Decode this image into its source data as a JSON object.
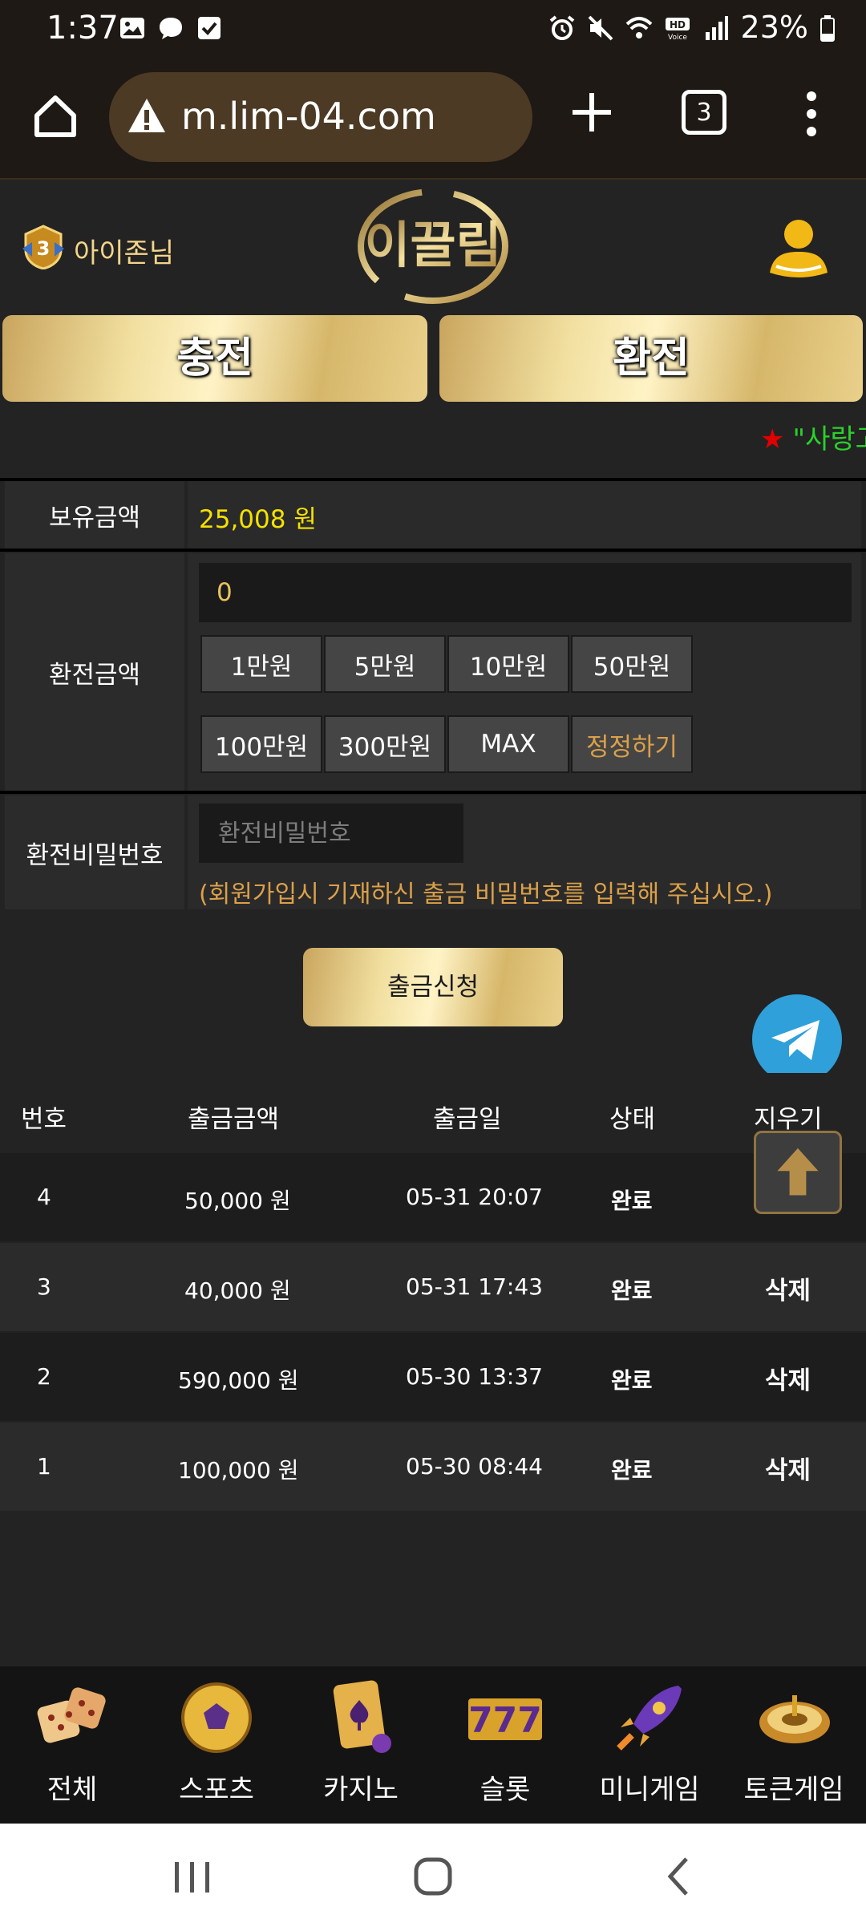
{
  "status_bar": {
    "time": "1:37",
    "battery": "23%"
  },
  "browser": {
    "url": "m.lim-04.com",
    "tab_count": "3"
  },
  "header": {
    "user_name": "아이존님",
    "level_badge": "3",
    "logo_text": "이끌림"
  },
  "actions": {
    "charge_label": "충전",
    "exchange_label": "환전"
  },
  "marquee": {
    "star": "★",
    "text": "\"사랑고"
  },
  "form": {
    "balance_label": "보유금액",
    "balance_value": "25,008 원",
    "amount_label": "환전금액",
    "amount_value": "0",
    "amount_buttons": [
      "1만원",
      "5만원",
      "10만원",
      "50만원",
      "100만원",
      "300만원",
      "MAX",
      "정정하기"
    ],
    "password_label": "환전비밀번호",
    "password_placeholder": "환전비밀번호",
    "password_hint": "(회원가입시 기재하신 출금 비밀번호를 입력해 주십시오.)",
    "submit_label": "출금신청"
  },
  "history": {
    "headers": [
      "번호",
      "출금금액",
      "출금일",
      "상태",
      "지우기"
    ],
    "rows": [
      {
        "no": "4",
        "amount": "50,000 원",
        "date": "05-31 20:07",
        "status": "완료",
        "delete": ""
      },
      {
        "no": "3",
        "amount": "40,000 원",
        "date": "05-31 17:43",
        "status": "완료",
        "delete": "삭제"
      },
      {
        "no": "2",
        "amount": "590,000 원",
        "date": "05-30 13:37",
        "status": "완료",
        "delete": "삭제"
      },
      {
        "no": "1",
        "amount": "100,000 원",
        "date": "05-30 08:44",
        "status": "완료",
        "delete": "삭제"
      }
    ]
  },
  "bottom_nav": [
    {
      "label": "전체",
      "icon": "dice-icon"
    },
    {
      "label": "스포츠",
      "icon": "soccer-ball-icon"
    },
    {
      "label": "카지노",
      "icon": "cards-icon"
    },
    {
      "label": "슬롯",
      "icon": "slot-777-icon"
    },
    {
      "label": "미니게임",
      "icon": "rocket-icon"
    },
    {
      "label": "토큰게임",
      "icon": "roulette-icon"
    }
  ],
  "slot_text": "777",
  "colors": {
    "gold": "#e9d08b",
    "balance_yellow": "#f5e100",
    "hint_orange": "#dba049",
    "marquee_green": "#2ad12a",
    "telegram_blue": "#2fa0da"
  }
}
